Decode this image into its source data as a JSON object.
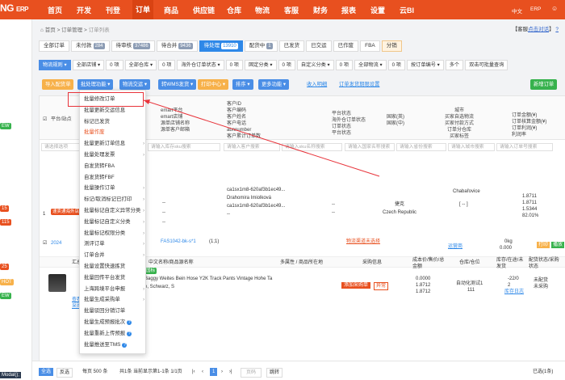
{
  "nav": {
    "logo": "NG",
    "logo_prefix": "N",
    "erp": "ERP",
    "items": [
      "首页",
      "开发",
      "刊登",
      "订单",
      "商品",
      "供应链",
      "仓库",
      "物流",
      "客服",
      "财务",
      "报表",
      "设置",
      "云BI"
    ],
    "active_index": 3,
    "lang": "中文",
    "app": "ERP"
  },
  "sidebar": {
    "badges": [
      "EW",
      "15",
      "115",
      "25",
      "HOT",
      "EW"
    ],
    "tail": "Modal();"
  },
  "breadcrumb": {
    "home": "首页",
    "sep1": ">",
    "module": "订单管理",
    "sep2": ">",
    "current": "订单列表"
  },
  "topright": {
    "text1": "【客服",
    "link1": "点击对话",
    "text2": "】",
    "link2": "?"
  },
  "tabs": [
    {
      "label": "全部订单",
      "count": ""
    },
    {
      "label": "未付款",
      "count": "284"
    },
    {
      "label": "待审核",
      "count": "37486"
    },
    {
      "label": "待合并",
      "count": "9436"
    },
    {
      "label": "待处理",
      "count": "13910"
    },
    {
      "label": "配货中",
      "count": "1"
    },
    {
      "label": "已发货",
      "count": ""
    },
    {
      "label": "已交运",
      "count": ""
    },
    {
      "label": "已作废",
      "count": ""
    },
    {
      "label": "FBA",
      "count": ""
    },
    {
      "label": "分销",
      "count": ""
    }
  ],
  "filters": [
    "物流规则 ▾",
    "全部店铺 ▾",
    "0 项",
    "全部仓库 ▾",
    "0 项",
    "海外仓订单状态 ▾",
    "0 项",
    "固定分类 ▾",
    "0 项",
    "自定义分类 ▾",
    "0 项",
    "全部物流 ▾",
    "0 项",
    "按订单编号 ▾",
    "多个",
    "双击可批量查询"
  ],
  "actions": {
    "import": "导入配货单",
    "batch": "批处理功能 ▾",
    "logistics": "物流交运 ▾",
    "wms": "转WMS发货 ▾",
    "print": "打印中心 ▾",
    "sort": "排序 ▾",
    "more": "更多功能 ▾",
    "packing": "收入明细",
    "setting": "订单发货期限设置",
    "new_order": "新增订单"
  },
  "table_header": {
    "platform": "平台/站点",
    "store_cols": [
      "emart平台",
      "emart店铺",
      "源单店铺名称",
      "源单客户邮箱"
    ],
    "customer": [
      "客户ID",
      "客户编码",
      "客户姓名",
      "客户电话",
      "abnnumber",
      "客户累计订单数"
    ],
    "platform_status": [
      "平台状态",
      "海外仓订单状态",
      "订单状态",
      "平台状态"
    ],
    "country": [
      "国家(英)",
      "国家(中)"
    ],
    "city": [
      "城市",
      "买家自选物流",
      "买家付款方式",
      "订单分仓库",
      "买家标签"
    ],
    "amount": [
      "订单金额(¥)",
      "订单核算金额(¥)",
      "订单利润(¥)",
      "利润率"
    ]
  },
  "search": {
    "p1": "请输入库存sku搜索",
    "p2": "请输入客户搜索",
    "p3": "请输入sku名称搜索",
    "p4": "请输入国家名称搜索",
    "p5": "请输入省份搜索",
    "p6": "请输入城市搜索",
    "p7": "请输入订单号搜索",
    "p_left": "请选择选项"
  },
  "row1": {
    "index": "1",
    "tag": "速卖通海外店",
    "dash": "--",
    "customer": "Drahomira Imiolková",
    "hash1": "ca1sx1m8-620af3b1ec49...",
    "hash2": "ca1sx1m8-620af3b1ec49...",
    "country_en": "捷克",
    "country_cn": "Czech Republic",
    "city": "Chabařovice",
    "amounts": [
      "1.8711",
      "1.8711",
      "1.5344",
      "82.01%"
    ],
    "brackets": "[ -- ]"
  },
  "row1b": {
    "date": "2024",
    "sku": "FAS1042-bk-s*1",
    "qty": "(1;1)",
    "logistics_link": "物流渠道未选择",
    "source": "运营商",
    "weight": "0kg",
    "weight2": "0.000",
    "badges": [
      "打印",
      "播放"
    ]
  },
  "subheader": {
    "summary": "汇总",
    "cols": [
      "中文名称/商品源名称",
      "多属性 / 商品所在地",
      "采购信息",
      "成本价/售价/总金额",
      "仓库/仓位",
      "库存/在途/未发货",
      "配货状态/采购状态"
    ]
  },
  "product": {
    "tag": "国标",
    "name1": "Baggy Weites Bein Hose Y2K Track Pants Vintage Hohe Ta",
    "name2": "e, Schwarz, S",
    "img_caption": "查看原图",
    "img_link": "采购链接",
    "purchase_btn": "添加采购单",
    "warning": "异常",
    "prices": [
      "0.0000",
      "1.8712",
      "1.8712"
    ],
    "warehouse": "自动化测试1",
    "loc": "111",
    "stock": "-22/0",
    "stock2": "2",
    "stock_link": "库存日志",
    "status": [
      "未配货",
      "未采购"
    ]
  },
  "menu": {
    "items": [
      {
        "label": "批量修改订单",
        "arrow": false,
        "danger": false,
        "q": false
      },
      {
        "label": "批量更新交运信息",
        "arrow": false,
        "danger": false,
        "q": false
      },
      {
        "label": "标记已发货",
        "arrow": false,
        "danger": false,
        "q": false
      },
      {
        "label": "批量作废",
        "arrow": false,
        "danger": true,
        "q": false
      },
      {
        "label": "批量更新订单信息",
        "arrow": true,
        "danger": false,
        "q": false
      },
      {
        "label": "批量处理发票",
        "arrow": true,
        "danger": false,
        "q": false
      },
      {
        "label": "自发货转FBA",
        "arrow": false,
        "danger": false,
        "q": false
      },
      {
        "label": "自发货转FBF",
        "arrow": false,
        "danger": false,
        "q": false
      },
      {
        "label": "批量操作订单",
        "arrow": true,
        "danger": false,
        "q": false
      },
      {
        "label": "标记/取消标记已打印",
        "arrow": true,
        "danger": false,
        "q": false
      },
      {
        "label": "批量标记自定义异常分类",
        "arrow": true,
        "danger": false,
        "q": false
      },
      {
        "label": "批量标记自定义分类",
        "arrow": true,
        "danger": false,
        "q": false
      },
      {
        "label": "批量标记权限分类",
        "arrow": true,
        "danger": false,
        "q": false
      },
      {
        "label": "测评订单",
        "arrow": true,
        "danger": false,
        "q": false
      },
      {
        "label": "订单合并",
        "arrow": true,
        "danger": false,
        "q": false
      },
      {
        "label": "批量设置快速拣货",
        "arrow": false,
        "danger": false,
        "q": false
      },
      {
        "label": "批量回传平台发货",
        "arrow": false,
        "danger": false,
        "q": false
      },
      {
        "label": "上海跨境平台申报",
        "arrow": true,
        "danger": false,
        "q": false
      },
      {
        "label": "批量生成采购单",
        "arrow": true,
        "danger": false,
        "q": false
      },
      {
        "label": "批量驳回分销订单",
        "arrow": false,
        "danger": false,
        "q": false
      },
      {
        "label": "批量生成预报批次",
        "arrow": false,
        "danger": false,
        "q": true
      },
      {
        "label": "批量重新上传预报",
        "arrow": false,
        "danger": false,
        "q": true
      },
      {
        "label": "批量推送至TMS",
        "arrow": false,
        "danger": false,
        "q": true
      }
    ]
  },
  "pagination": {
    "select_all": "全选",
    "invert": "反选",
    "per_page": "每页 500 条",
    "summary": "共1条 当前显示第1-1条 1/1页",
    "first": "|‹",
    "prev": "‹",
    "page": "1",
    "next": "›",
    "last": "›|",
    "goto_placeholder": "页码",
    "goto": "跳转",
    "count": "已选(1条)"
  },
  "colors": {
    "brand": "#e8501f",
    "primary": "#2e88e8",
    "orange": "#f7b14a",
    "green": "#37b24d",
    "highlight": "#e8333a"
  }
}
